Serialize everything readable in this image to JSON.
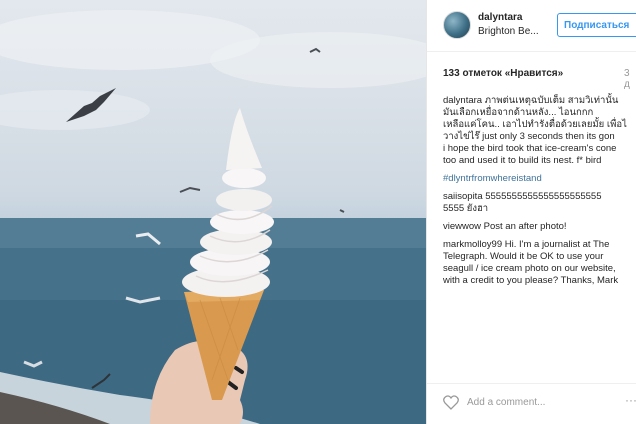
{
  "post": {
    "username": "dalyntara",
    "location": "Brighton Be...",
    "follow_label": "Подписаться",
    "likes": "133 отметок «Нравится»",
    "time": "3 д",
    "caption_lines": [
      "dalyntara ภาพต่นเหตุฉบับเต็ม สามวิเท่านั้น",
      "มันเลือกเหยื่อจากด้านหลัง... ไอนกกก",
      "เหลือแค่โคน.. เอาไปทำรังตื่อด้วยเลยมั้ย เพื่อไ",
      "วางไข่ไร๊ just only 3 seconds then its gon",
      "i hope the bird took that ice-cream's cone",
      "too and used it to build its nest. f* bird"
    ],
    "hashtag": "#dlyntrfromwhereistand",
    "comments": [
      {
        "user": "saiisopita",
        "lines": [
          "saiisopita 5555555555555555555555",
          "5555 ยังฮา"
        ]
      },
      {
        "user": "viewwow",
        "lines": [
          "viewwow Post an after photo!"
        ]
      },
      {
        "user": "markmolloy99",
        "lines": [
          "markmolloy99 Hi. I'm a journalist at The",
          "Telegraph. Would it be OK to use your",
          "seagull / ice cream photo on our website,",
          "with a credit to you please? Thanks, Mark"
        ]
      }
    ],
    "comment_placeholder": "Add a comment...",
    "more_label": "···"
  }
}
